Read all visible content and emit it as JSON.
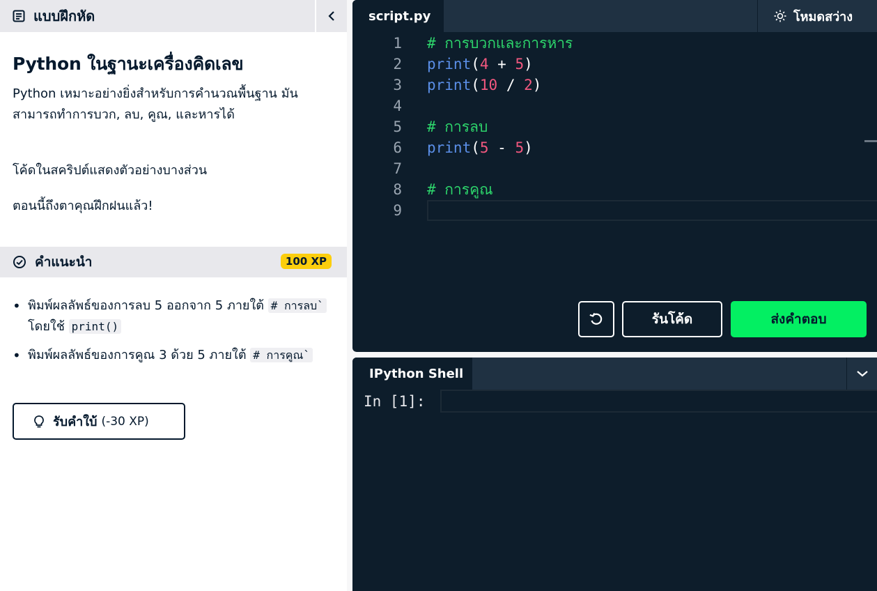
{
  "left": {
    "header_title": "แบบฝึกหัด",
    "exercise": {
      "title": "Python ในฐานะเครื่องคิดเลข",
      "description": "Python เหมาะอย่างยิ่งสำหรับการคำนวณพื้นฐาน มันสามารถทำการบวก, ลบ, คูณ, และหารได้",
      "paragraph_1": "โค้ดในสคริปต์แสดงตัวอย่างบางส่วน",
      "paragraph_2": "ตอนนี้ถึงตาคุณฝึกฝนแล้ว!"
    },
    "instructions": {
      "header_title": "คำแนะนำ",
      "xp_badge": "100 XP",
      "items": [
        {
          "text_a": "พิมพ์ผลลัพธ์ของการลบ 5 ออกจาก 5 ภายใต้",
          "code_a": "# การลบ`",
          "text_b": "โดยใช้",
          "code_b": "print()"
        },
        {
          "text_a": "พิมพ์ผลลัพธ์ของการคูณ 3 ด้วย 5 ภายใต้",
          "code_a": "# การคูณ`"
        }
      ],
      "hint_button": {
        "label": "รับคำใบ้",
        "cost": "(-30 XP)"
      }
    }
  },
  "editor": {
    "tab_label": "script.py",
    "light_mode_label": "โหมดสว่าง",
    "lines": [
      {
        "num": "1",
        "tokens": [
          {
            "t": "# การบวกและการหาร",
            "c": "comment"
          }
        ]
      },
      {
        "num": "2",
        "tokens": [
          {
            "t": "print",
            "c": "fn"
          },
          {
            "t": "(",
            "c": "op"
          },
          {
            "t": "4",
            "c": "num"
          },
          {
            "t": " + ",
            "c": "op"
          },
          {
            "t": "5",
            "c": "num"
          },
          {
            "t": ")",
            "c": "op"
          }
        ]
      },
      {
        "num": "3",
        "tokens": [
          {
            "t": "print",
            "c": "fn"
          },
          {
            "t": "(",
            "c": "op"
          },
          {
            "t": "10",
            "c": "num"
          },
          {
            "t": " / ",
            "c": "op"
          },
          {
            "t": "2",
            "c": "num"
          },
          {
            "t": ")",
            "c": "op"
          }
        ]
      },
      {
        "num": "4",
        "tokens": []
      },
      {
        "num": "5",
        "tokens": [
          {
            "t": "# การลบ",
            "c": "comment"
          }
        ]
      },
      {
        "num": "6",
        "tokens": [
          {
            "t": "print",
            "c": "fn"
          },
          {
            "t": "(",
            "c": "op"
          },
          {
            "t": "5",
            "c": "num"
          },
          {
            "t": " - ",
            "c": "op"
          },
          {
            "t": "5",
            "c": "num"
          },
          {
            "t": ")",
            "c": "op"
          }
        ]
      },
      {
        "num": "7",
        "tokens": []
      },
      {
        "num": "8",
        "tokens": [
          {
            "t": "# การคูณ",
            "c": "comment"
          }
        ]
      },
      {
        "num": "9",
        "tokens": []
      }
    ],
    "run_button": "รันโค้ด",
    "submit_button": "ส่งคำตอบ"
  },
  "shell": {
    "tab_label": "IPython Shell",
    "prompt": "In [1]:"
  },
  "colors": {
    "editor_bg": "#0d1d2b",
    "tab_bar_bg": "#1f3142",
    "submit_green": "#03ef62",
    "xp_yellow": "#fcce0d",
    "comment_green": "#2dd46b",
    "function_blue": "#5b8fe8",
    "number_pink": "#f2587f"
  }
}
